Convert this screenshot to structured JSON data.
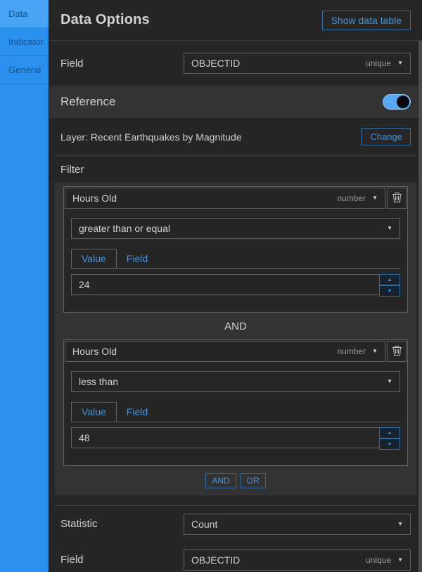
{
  "colors": {
    "accent_blue_text": "#4493DD",
    "accent_blue_border": "#2E6DA4",
    "sidebar_blue": "#2B8FEE",
    "sidebar_selected_blue": "#47A3F4",
    "panel_dark": "#262626",
    "panel_light": "#333333",
    "toggle_on_blue": "#57A7F1",
    "text_light": "#CFCFCF",
    "text_muted": "#979797"
  },
  "icons": {
    "dropdown_caret": "▼",
    "spinner_up": "▲",
    "spinner_down": "▼",
    "delete": "trash-icon"
  },
  "sidebar": {
    "tabs": [
      {
        "label": "Data",
        "selected": true
      },
      {
        "label": "Indicator",
        "selected": false
      },
      {
        "label": "General",
        "selected": false
      }
    ]
  },
  "header": {
    "title": "Data Options",
    "show_data_table": "Show data table"
  },
  "field_top": {
    "label": "Field",
    "value": "OBJECTID",
    "value_type": "unique"
  },
  "reference": {
    "label": "Reference",
    "enabled": true,
    "layer": "Layer: Recent Earthquakes by Magnitude",
    "change_button": "Change"
  },
  "filter": {
    "label": "Filter",
    "connector": "AND",
    "add_condition_buttons": [
      "AND",
      "OR"
    ],
    "conditions": [
      {
        "field": "Hours Old",
        "field_type": "number",
        "operator": "greater than or equal",
        "tabs": [
          "Value",
          "Field"
        ],
        "active_tab": "Value",
        "value": "24"
      },
      {
        "field": "Hours Old",
        "field_type": "number",
        "operator": "less than",
        "tabs": [
          "Value",
          "Field"
        ],
        "active_tab": "Value",
        "value": "48"
      }
    ]
  },
  "statistic": {
    "label": "Statistic",
    "value": "Count"
  },
  "field_bottom": {
    "label": "Field",
    "value": "OBJECTID",
    "value_type": "unique"
  }
}
